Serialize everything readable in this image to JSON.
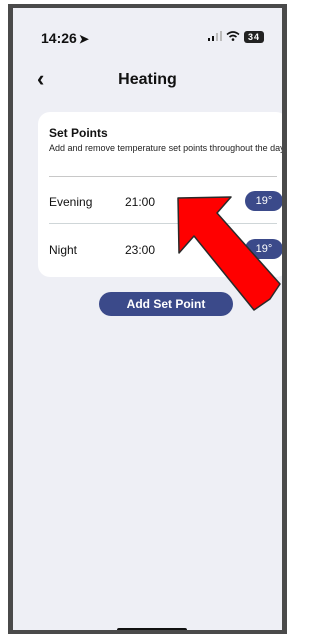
{
  "status_bar": {
    "time": "14:26",
    "location_icon": "location-arrow-icon",
    "signal_icon": "signal-icon",
    "wifi_icon": "wifi-icon",
    "battery": "34"
  },
  "nav": {
    "back_icon": "chevron-left-icon",
    "back_glyph": "‹",
    "title": "Heating"
  },
  "set_points_card": {
    "title": "Set Points",
    "description": "Add and remove temperature set points throughout the day",
    "items": [
      {
        "name": "Evening",
        "time": "21:00",
        "temperature": "19°"
      },
      {
        "name": "Night",
        "time": "23:00",
        "temperature": "19°"
      }
    ]
  },
  "add_button": {
    "label": "Add Set Point"
  },
  "colors": {
    "accent": "#3b4a8a",
    "background": "#eeeff5",
    "card": "#ffffff",
    "annotation_arrow": "#ff0000"
  }
}
